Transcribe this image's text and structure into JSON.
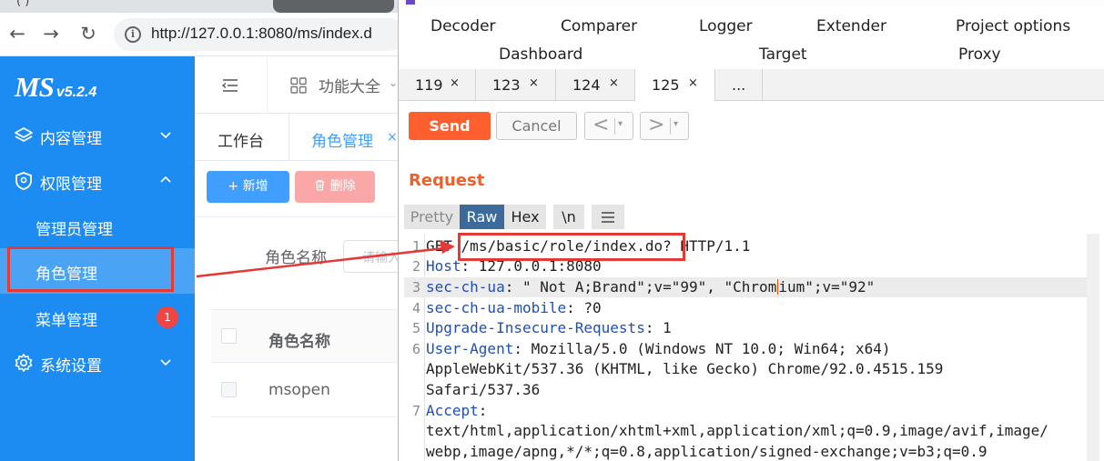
{
  "browser": {
    "tab_fragment": "(     )",
    "url": "http://127.0.0.1:8080/ms/index.d",
    "back_glyph": "←",
    "forward_glyph": "→",
    "reload_glyph": "↻",
    "info_glyph": "i"
  },
  "app": {
    "logo": "MS",
    "version": "v5.2.4",
    "menu": {
      "content": "内容管理",
      "permission": "权限管理",
      "admin": "管理员管理",
      "role": "角色管理",
      "menu_mgmt": "菜单管理",
      "menu_badge": "1",
      "system": "系统设置"
    },
    "topbar": {
      "features": "功能大全",
      "chevron": "⌄"
    },
    "page_tabs": {
      "workbench": "工作台",
      "role": "角色管理",
      "close": "×"
    },
    "toolbar": {
      "add": "+ 新增",
      "delete": "删除"
    },
    "search": {
      "label": "角色名称",
      "placeholder": "请输入"
    },
    "table": {
      "header": "角色名称",
      "rows": [
        "msopen"
      ]
    }
  },
  "burp": {
    "menu_row1": [
      "Decoder",
      "Comparer",
      "Logger",
      "Extender",
      "Project options"
    ],
    "menu_row2": [
      "Dashboard",
      "Target",
      "Proxy"
    ],
    "tabs": [
      "119",
      "123",
      "124",
      "125",
      "..."
    ],
    "tab_close": "×",
    "send": "Send",
    "cancel": "Cancel",
    "prev": "<",
    "next": ">",
    "dropdown": "▾",
    "request_title": "Request",
    "view_tabs": {
      "pretty": "Pretty",
      "raw": "Raw",
      "hex": "Hex",
      "newline": "\\n"
    },
    "lines": [
      {
        "num": "1",
        "method": "GET",
        "path": "/ms/basic/role/index.do?",
        "rest": " HTTP/1.1"
      },
      {
        "num": "2",
        "key": "Host",
        "value": ": 127.0.0.1:8080"
      },
      {
        "num": "3",
        "key": "sec-ch-ua",
        "value_a": ": \" Not A;Brand\";v=\"99\", \"Chrom",
        "value_b": "ium\";v=\"92\""
      },
      {
        "num": "4",
        "key": "sec-ch-ua-mobile",
        "value": ": ?0"
      },
      {
        "num": "5",
        "key": "Upgrade-Insecure-Requests",
        "value": ": 1"
      },
      {
        "num": "6",
        "key": "User-Agent",
        "value": ": Mozilla/5.0 (Windows NT 10.0; Win64; x64)"
      },
      {
        "cont": "AppleWebKit/537.36 (KHTML, like Gecko) Chrome/92.0.4515.159"
      },
      {
        "cont": "Safari/537.36"
      },
      {
        "num": "7",
        "key": "Accept",
        "value": ":"
      },
      {
        "cont": "text/html,application/xhtml+xml,application/xml;q=0.9,image/avif,image/"
      },
      {
        "cont": "webp,image/apng,*/*;q=0.8,application/signed-exchange;v=b3;q=0.9"
      }
    ]
  },
  "colors": {
    "sidebar": "#1c8cf2",
    "send": "#ff5f2e",
    "annotation": "#e53935",
    "raw_tab": "#3b6a9b",
    "header_key": "#1f4fb8"
  }
}
